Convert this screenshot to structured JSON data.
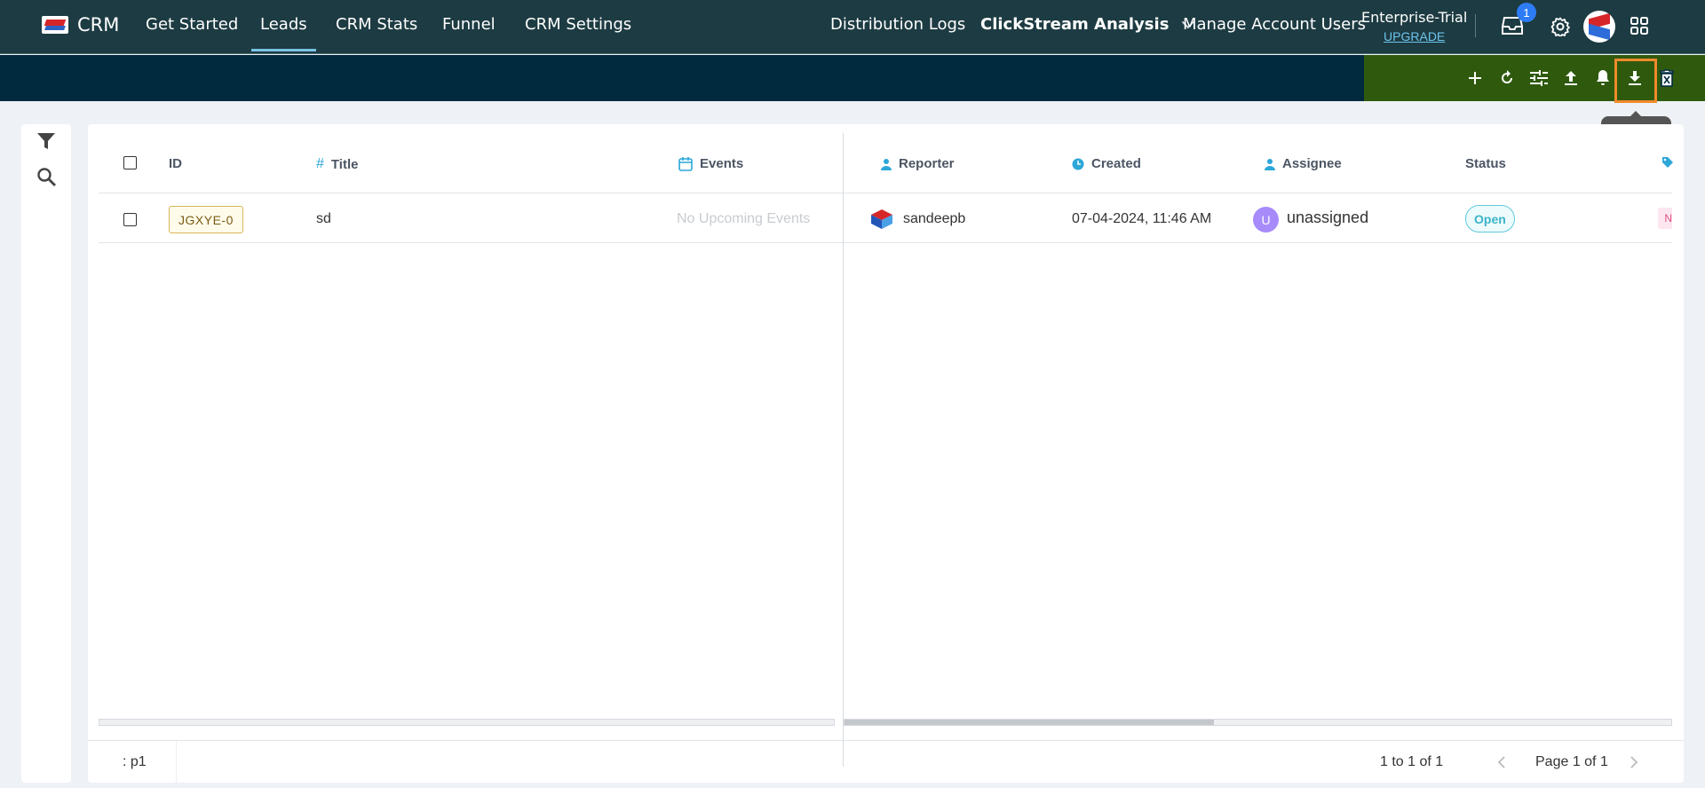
{
  "app": {
    "brand": "CRM",
    "nav": [
      {
        "label": "Get Started"
      },
      {
        "label": "Leads"
      },
      {
        "label": "CRM Stats"
      },
      {
        "label": "Funnel"
      },
      {
        "label": "CRM Settings"
      }
    ],
    "nav_right": {
      "distribution_logs": "Distribution Logs",
      "clickstream": "ClickStream Analysis",
      "manage_users": "Manage Account Users"
    },
    "plan": {
      "name": "Enterprise-Trial",
      "upgrade": "UPGRADE"
    },
    "inbox_badge": "1",
    "colors": {
      "nav_bg": "#1d3b42",
      "actionbar_bg": "#022a3f",
      "action_zone_bg": "#2f5a0e",
      "active_underline": "#78c4e6",
      "highlight": "#f08a2c"
    }
  },
  "toolbar": {
    "icons": [
      "plus-icon",
      "refresh-icon",
      "tune-icon",
      "upload-icon",
      "bell-icon",
      "download-icon",
      "delete-icon"
    ],
    "tooltip": "Download"
  },
  "table": {
    "columns": {
      "id": "ID",
      "title": "Title",
      "events": "Events",
      "reporter": "Reporter",
      "created": "Created",
      "assignee": "Assignee",
      "status": "Status"
    },
    "rows": [
      {
        "id": "JGXYE-0",
        "title": "sd",
        "events": "No Upcoming Events",
        "reporter": "sandeepb",
        "created": "07-04-2024, 11:46 AM",
        "assignee_initial": "U",
        "assignee": "unassigned",
        "status": "Open",
        "tag_peek": "N"
      }
    ]
  },
  "footer": {
    "view": ": p1",
    "range": "1 to 1 of 1",
    "page": "Page 1 of 1"
  }
}
